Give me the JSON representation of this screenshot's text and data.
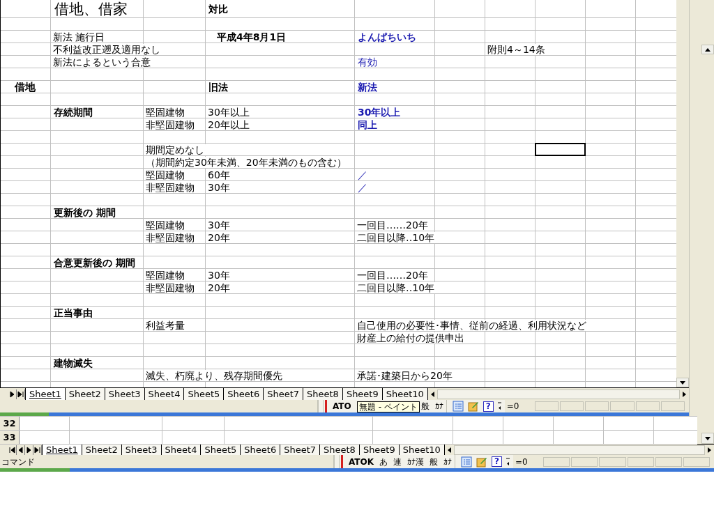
{
  "sheet": {
    "rows": [
      {
        "col_b": {
          "text": "借地、借家",
          "kind": "title"
        },
        "col_d": {
          "text": "対比",
          "kind": "bold"
        }
      },
      {},
      {
        "col_b": {
          "text": "新法  施行日",
          "kind": "plain"
        },
        "col_d": {
          "text": "平成4年8月1日",
          "kind": "bold_center"
        },
        "col_e": {
          "text": "よんぱちいち",
          "kind": "bold_blue"
        }
      },
      {
        "col_b": {
          "text": "不利益改正遡及適用なし",
          "kind": "plain"
        },
        "col_g": {
          "text": "附則4～14条",
          "kind": "plain"
        }
      },
      {
        "col_b": {
          "text": "新法によるという合意",
          "kind": "plain"
        },
        "col_e": {
          "text": "有効",
          "kind": "blue"
        }
      },
      {},
      {
        "col_a": {
          "text": "借地",
          "kind": "bold_large"
        },
        "col_d": {
          "text": "旧法",
          "kind": "bold"
        },
        "col_e": {
          "text": "新法",
          "kind": "bold_blue"
        }
      },
      {},
      {
        "col_b": {
          "text": "存続期間",
          "kind": "bold"
        },
        "col_c": {
          "text": "堅固建物",
          "kind": "plain"
        },
        "col_d": {
          "text": "30年以上",
          "kind": "plain"
        },
        "col_e": {
          "text": "30年以上",
          "kind": "bold_blue"
        }
      },
      {
        "col_c": {
          "text": "非堅固建物",
          "kind": "plain"
        },
        "col_d": {
          "text": "20年以上",
          "kind": "plain"
        },
        "col_e": {
          "text": "同上",
          "kind": "bold_blue"
        }
      },
      {},
      {
        "col_c": {
          "text": "期間定めなし",
          "kind": "plain"
        },
        "col_h": {
          "selected": true
        }
      },
      {
        "col_c": {
          "text": "（期間約定30年未満、20年未満のもの含む）",
          "kind": "plain"
        }
      },
      {
        "col_c": {
          "text": "堅固建物",
          "kind": "plain"
        },
        "col_d": {
          "text": "60年",
          "kind": "plain"
        },
        "col_e": {
          "text": "／",
          "kind": "blue"
        }
      },
      {
        "col_c": {
          "text": "非堅固建物",
          "kind": "plain"
        },
        "col_d": {
          "text": "30年",
          "kind": "plain"
        },
        "col_e": {
          "text": "／",
          "kind": "blue"
        }
      },
      {},
      {
        "col_b": {
          "text": "更新後の 期間",
          "kind": "bold"
        }
      },
      {
        "col_c": {
          "text": "堅固建物",
          "kind": "plain"
        },
        "col_d": {
          "text": "30年",
          "kind": "plain"
        },
        "col_e": {
          "text": "一回目……20年",
          "kind": "plain"
        }
      },
      {
        "col_c": {
          "text": "非堅固建物",
          "kind": "plain"
        },
        "col_d": {
          "text": "20年",
          "kind": "plain"
        },
        "col_e": {
          "text": "二回目以降‥10年",
          "kind": "plain"
        }
      },
      {},
      {
        "col_b": {
          "text": "合意更新後の 期間",
          "kind": "bold"
        }
      },
      {
        "col_c": {
          "text": "堅固建物",
          "kind": "plain"
        },
        "col_d": {
          "text": "30年",
          "kind": "plain"
        },
        "col_e": {
          "text": "一回目……20年",
          "kind": "plain"
        }
      },
      {
        "col_c": {
          "text": "非堅固建物",
          "kind": "plain"
        },
        "col_d": {
          "text": "20年",
          "kind": "plain"
        },
        "col_e": {
          "text": "二回目以降‥10年",
          "kind": "plain"
        }
      },
      {},
      {
        "col_b": {
          "text": "正当事由",
          "kind": "bold"
        }
      },
      {
        "col_c": {
          "text": "利益考量",
          "kind": "plain"
        },
        "col_e": {
          "text": "自己使用の必要性･事情、従前の経過、利用状況など",
          "kind": "plain"
        }
      },
      {
        "col_e": {
          "text": "財産上の給付の提供申出",
          "kind": "plain"
        }
      },
      {},
      {
        "col_b": {
          "text": "建物滅失",
          "kind": "bold"
        }
      },
      {
        "col_c": {
          "text": "滅失、朽廃より、残存期間優先",
          "kind": "plain"
        },
        "col_e": {
          "text": "承諾･建築日から20年",
          "kind": "plain"
        }
      }
    ]
  },
  "tab_bar": {
    "tabs": [
      {
        "label": "Sheet1",
        "selected": true
      },
      {
        "label": "Sheet2",
        "selected": false
      },
      {
        "label": "Sheet3",
        "selected": false
      },
      {
        "label": "Sheet4",
        "selected": false
      },
      {
        "label": "Sheet5",
        "selected": false
      },
      {
        "label": "Sheet6",
        "selected": false
      },
      {
        "label": "Sheet7",
        "selected": false
      },
      {
        "label": "Sheet8",
        "selected": false
      },
      {
        "label": "Sheet9",
        "selected": false
      },
      {
        "label": "Sheet10",
        "selected": false
      }
    ]
  },
  "status_bar": {
    "ime_items": [
      "ATO"
    ],
    "tooltip": "無題 - ペイント",
    "ime_items_after": [
      "般",
      "ｶﾅ"
    ],
    "help_glyph": "?",
    "formula": "=0"
  },
  "lower_window": {
    "row_headers": [
      "32",
      "33"
    ],
    "tab_bar": {
      "tabs": [
        {
          "label": "Sheet1",
          "selected": true
        },
        {
          "label": "Sheet2",
          "selected": false
        },
        {
          "label": "Sheet3",
          "selected": false
        },
        {
          "label": "Sheet4",
          "selected": false
        },
        {
          "label": "Sheet5",
          "selected": false
        },
        {
          "label": "Sheet6",
          "selected": false
        },
        {
          "label": "Sheet7",
          "selected": false
        },
        {
          "label": "Sheet8",
          "selected": false
        },
        {
          "label": "Sheet9",
          "selected": false
        },
        {
          "label": "Sheet10",
          "selected": false
        }
      ]
    },
    "status_bar": {
      "mode": "コマンド",
      "ime_items": [
        "ATOK",
        "あ",
        "連",
        "ｶﾅ漢",
        "般",
        "ｶﾅ"
      ],
      "help_glyph": "?",
      "formula": "=0"
    }
  }
}
